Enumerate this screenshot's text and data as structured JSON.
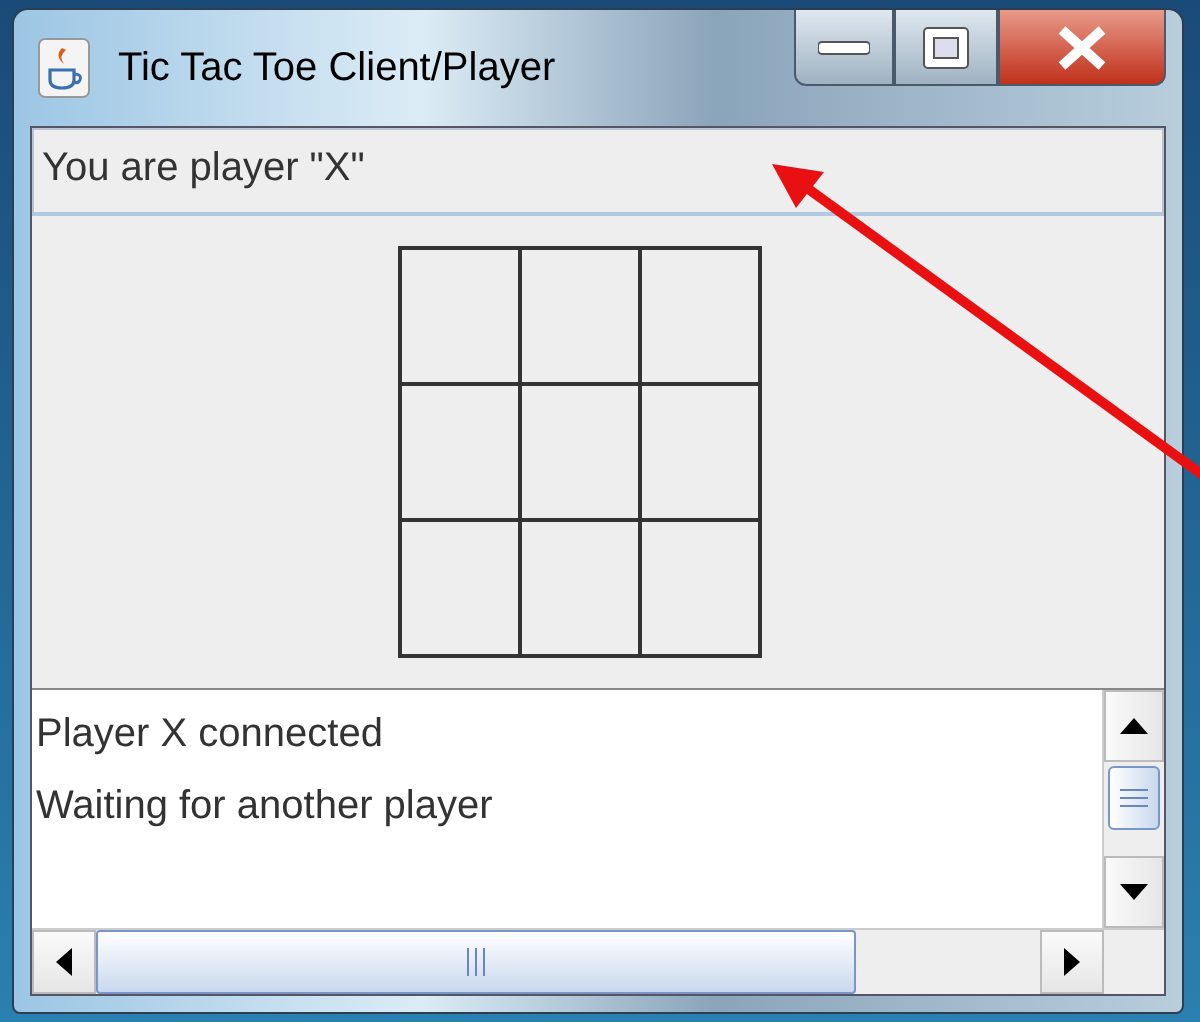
{
  "window": {
    "title": "Tic Tac Toe Client/Player"
  },
  "status_label": "You are player \"X\"",
  "log": {
    "lines": [
      "Player X connected",
      "Waiting for another player"
    ]
  }
}
